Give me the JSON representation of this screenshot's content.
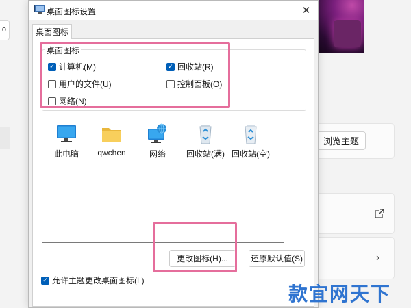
{
  "dialog": {
    "title": "桌面图标设置",
    "tab": "桌面图标",
    "group_label": "桌面图标",
    "checkboxes": [
      {
        "label": "计算机(M)",
        "checked": true
      },
      {
        "label": "回收站(R)",
        "checked": true
      },
      {
        "label": "用户的文件(U)",
        "checked": false
      },
      {
        "label": "控制面板(O)",
        "checked": false
      },
      {
        "label": "网络(N)",
        "checked": false
      }
    ],
    "icons": [
      {
        "label": "此电脑",
        "icon": "monitor-icon"
      },
      {
        "label": "qwchen",
        "icon": "folder-icon"
      },
      {
        "label": "网络",
        "icon": "network-icon"
      },
      {
        "label": "回收站(满)",
        "icon": "recycle-bin-full-icon"
      },
      {
        "label": "回收站(空)",
        "icon": "recycle-bin-empty-icon"
      }
    ],
    "change_icon_button": "更改图标(H)...",
    "restore_default_button": "还原默认值(S)",
    "allow_themes": {
      "label": "允许主题更改桌面图标(L)",
      "checked": true
    },
    "close_symbol": "✕"
  },
  "background": {
    "browse_themes_button": "浏览主题",
    "partial_button_text": "o"
  },
  "watermark": "款宜网天下",
  "colors": {
    "accent": "#005fb8",
    "highlight": "#e56e9c",
    "watermark": "#2f74d0"
  }
}
